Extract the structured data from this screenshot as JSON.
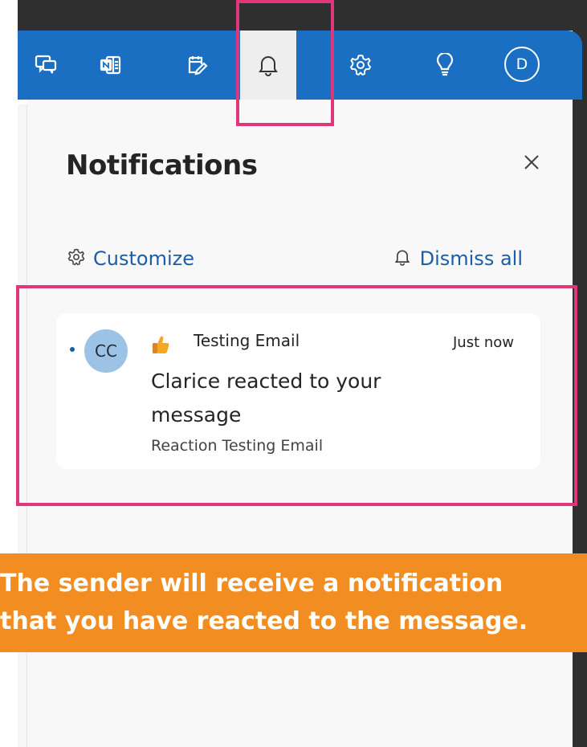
{
  "top_bar": {
    "buttons": [
      {
        "name": "chat",
        "icon": "chat-icon"
      },
      {
        "name": "onenote",
        "icon": "onenote-icon"
      },
      {
        "name": "to-do",
        "icon": "todo-icon"
      },
      {
        "name": "notifications",
        "icon": "bell-icon",
        "active": true
      },
      {
        "name": "settings",
        "icon": "gear-icon"
      },
      {
        "name": "tips",
        "icon": "lightbulb-icon"
      }
    ],
    "avatar_initial": "D",
    "background_color": "#1a6fc2"
  },
  "panel": {
    "title": "Notifications",
    "customize_label": "Customize",
    "dismiss_all_label": "Dismiss all",
    "link_color": "#1a5ea8"
  },
  "notification": {
    "sender_initials": "CC",
    "reaction_icon": "thumbs-up-icon",
    "subject": "Testing Email",
    "time": "Just now",
    "message": "Clarice reacted to your message",
    "preview": "Reaction Testing Email",
    "unread": true
  },
  "highlight_color": "#e0377c",
  "caption": {
    "line1": "The sender will receive a notification",
    "line2": "that you have reacted to the message.",
    "background_color": "#f28d21"
  }
}
